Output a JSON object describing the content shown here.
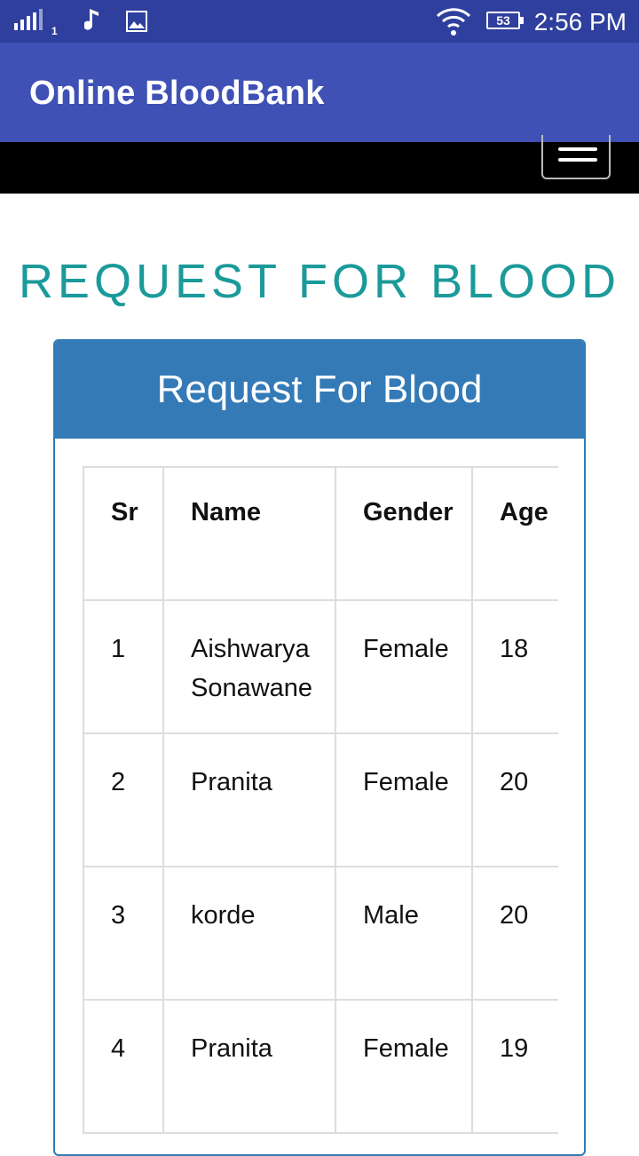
{
  "status_bar": {
    "sim_number": "1",
    "battery_level": "53",
    "time": "2:56 PM",
    "icons": [
      "signal-icon",
      "music-note-icon",
      "gallery-icon",
      "wifi-icon",
      "battery-icon"
    ]
  },
  "app_bar": {
    "title": "Online BloodBank"
  },
  "navbar": {
    "menu_icon": "hamburger-menu-icon"
  },
  "page": {
    "heading": "REQUEST FOR BLOOD",
    "panel_title": "Request For Blood",
    "table": {
      "headers": [
        "Sr",
        "Name",
        "Gender",
        "Age"
      ],
      "rows": [
        {
          "sr": "1",
          "name": "Aishwarya Sonawane",
          "gender": "Female",
          "age": "18"
        },
        {
          "sr": "2",
          "name": "Pranita",
          "gender": "Female",
          "age": "20"
        },
        {
          "sr": "3",
          "name": "korde",
          "gender": "Male",
          "age": "20"
        },
        {
          "sr": "4",
          "name": "Pranita",
          "gender": "Female",
          "age": "19"
        }
      ]
    }
  },
  "colors": {
    "status_bar": "#2f3f9e",
    "app_bar": "#3f51b5",
    "navbar": "#000000",
    "heading": "#1b9a9a",
    "panel": "#337ab7"
  }
}
